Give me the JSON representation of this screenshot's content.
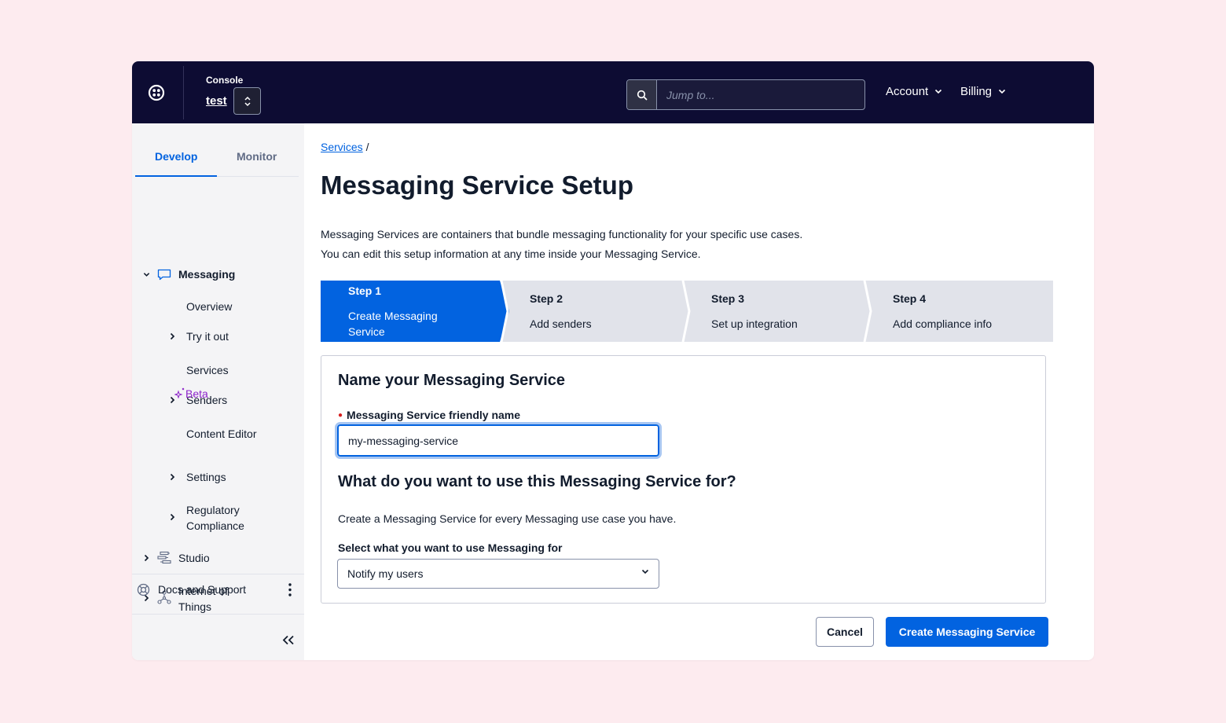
{
  "topbar": {
    "console_label": "Console",
    "account_name": "test",
    "search_placeholder": "Jump to...",
    "account_menu": "Account",
    "billing_menu": "Billing"
  },
  "sidebar": {
    "tabs": [
      "Develop",
      "Monitor"
    ],
    "active_tab": "Develop",
    "messaging": "Messaging",
    "items": {
      "overview": "Overview",
      "try_it_out": "Try it out",
      "services": "Services",
      "senders": "Senders",
      "content_editor": "Content Editor",
      "beta": "Beta",
      "settings": "Settings",
      "regulatory_1": "Regulatory",
      "regulatory_2": "Compliance"
    },
    "studio": "Studio",
    "iot_1": "Internet of",
    "iot_2": "Things",
    "docs": "Docs and Support"
  },
  "main": {
    "breadcrumb": "Services",
    "breadcrumb_sep": "/",
    "title": "Messaging Service Setup",
    "intro_1": "Messaging Services are containers that bundle messaging functionality for your specific use cases.",
    "intro_2": "You can edit this setup information at any time inside your Messaging Service.",
    "steps": [
      {
        "label": "Step 1",
        "desc_1": "Create Messaging",
        "desc_2": "Service"
      },
      {
        "label": "Step 2",
        "desc": "Add senders"
      },
      {
        "label": "Step 3",
        "desc": "Set up integration"
      },
      {
        "label": "Step 4",
        "desc": "Add compliance info"
      }
    ],
    "form": {
      "heading": "Name your Messaging Service",
      "name_label": "Messaging Service friendly name",
      "name_value": "my-messaging-service",
      "use_heading": "What do you want to use this Messaging Service for?",
      "use_help": "Create a Messaging Service for every Messaging use case you have.",
      "select_label": "Select what you want to use Messaging for",
      "select_value": "Notify my users"
    },
    "cancel_label": "Cancel",
    "create_label": "Create Messaging Service"
  },
  "colors": {
    "topbar": "#0d0c33",
    "primary": "#0263e0",
    "step_inactive": "#e1e3ea",
    "beta": "#8c23c9",
    "background": "#fdebef"
  }
}
